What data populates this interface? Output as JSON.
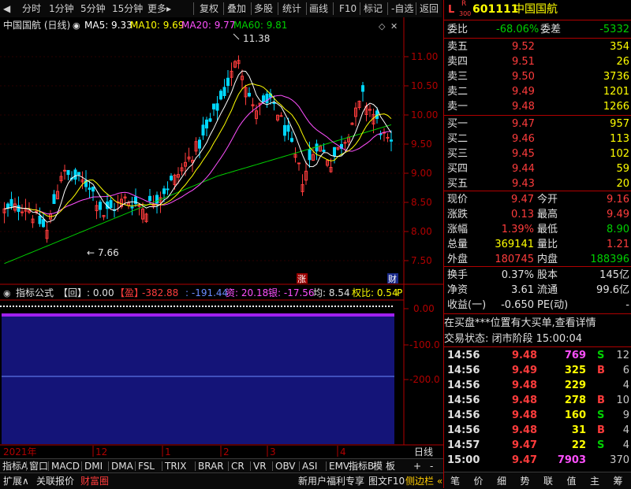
{
  "toolbar": {
    "left_items": [
      "分时",
      "1分钟",
      "5分钟",
      "15分钟",
      "更多"
    ],
    "right_items": [
      "复权",
      "叠加",
      "多股",
      "统计",
      "画线",
      "F10",
      "标记",
      "-自选",
      "返回"
    ]
  },
  "main_chart": {
    "title": "中国国航 (日线)",
    "ma5_label": "MA5: 9.33",
    "ma10_label": "MA10: 9.69",
    "ma20_label": "MA20: 9.77",
    "ma60_label": "MA60: 9.81",
    "high_mark": "11.38",
    "low_mark": "7.66",
    "y_ticks": [
      "11.00",
      "10.50",
      "10.00",
      "9.50",
      "9.00",
      "8.50",
      "8.00",
      "7.50"
    ],
    "badge_zhang": "涨",
    "badge_cai": "财",
    "colors": {
      "up": "#ff3c3c",
      "down": "#00d8ff",
      "ma5": "#ffffff",
      "ma10": "#ffff00",
      "ma20": "#ff50ff",
      "ma60": "#00d000"
    }
  },
  "indicator": {
    "name": "指标公式",
    "hui": "【回】: 0.00",
    "ying": "【盈】",
    "v1": "-382.88",
    "v2": ": -191.44",
    "zi": "资: 20.18",
    "yin": "银: -17.56",
    "jun": "均: 8.54",
    "quanbi": "权比: 0.54",
    "p": "P",
    "y_ticks": [
      "0.00",
      "-100.0",
      "-200.0"
    ]
  },
  "time_axis": {
    "labels": [
      "2021年",
      "12",
      "1",
      "2",
      "3",
      "4"
    ],
    "right_label": "日线"
  },
  "indicator_tabs": [
    "指标A",
    "窗口",
    "MACD",
    "DMI",
    "DMA",
    "FSL",
    "TRIX",
    "BRAR",
    "CR",
    "VR",
    "OBV",
    "ASI",
    "EMV"
  ],
  "indicator_tabs_right": [
    "指标B",
    "模",
    "板",
    "+",
    "-"
  ],
  "bottom_tabs": [
    "扩展∧",
    "关联报价",
    "财富圈"
  ],
  "bottom_right": [
    "新用户福利专享",
    "图文F10",
    "侧边栏 «"
  ],
  "quote": {
    "logo_l": "L",
    "logo_r": "R",
    "logo_num": "300",
    "code": "601111",
    "name": "中国国航",
    "weibi_label": "委比",
    "weibi": "-68.06%",
    "weicha_label": "委差",
    "weicha": "-5332",
    "asks": [
      {
        "label": "卖五",
        "price": "9.52",
        "vol": "354"
      },
      {
        "label": "卖四",
        "price": "9.51",
        "vol": "26"
      },
      {
        "label": "卖三",
        "price": "9.50",
        "vol": "3736"
      },
      {
        "label": "卖二",
        "price": "9.49",
        "vol": "1201"
      },
      {
        "label": "卖一",
        "price": "9.48",
        "vol": "1266"
      }
    ],
    "bids": [
      {
        "label": "买一",
        "price": "9.47",
        "vol": "957"
      },
      {
        "label": "买二",
        "price": "9.46",
        "vol": "113"
      },
      {
        "label": "买三",
        "price": "9.45",
        "vol": "102"
      },
      {
        "label": "买四",
        "price": "9.44",
        "vol": "59"
      },
      {
        "label": "买五",
        "price": "9.43",
        "vol": "20"
      }
    ],
    "stats": [
      {
        "l1": "现价",
        "v1": "9.47",
        "l2": "今开",
        "v2": "9.16"
      },
      {
        "l1": "涨跌",
        "v1": "0.13",
        "l2": "最高",
        "v2": "9.49"
      },
      {
        "l1": "涨幅",
        "v1": "1.39%",
        "l2": "最低",
        "v2": "8.90"
      },
      {
        "l1": "总量",
        "v1": "369141",
        "l2": "量比",
        "v2": "1.21"
      },
      {
        "l1": "外盘",
        "v1": "180745",
        "l2": "内盘",
        "v2": "188396"
      }
    ],
    "stats2": [
      {
        "l1": "换手",
        "v1": "0.37%",
        "l2": "股本",
        "v2": "145亿"
      },
      {
        "l1": "净资",
        "v1": "3.61",
        "l2": "流通",
        "v2": "99.6亿"
      },
      {
        "l1": "收益(一)",
        "v1": "-0.650",
        "l2": "PE(动)",
        "v2": "-"
      }
    ],
    "notice": "在买盘***位置有大买单,查看详情",
    "status": "交易状态: 闭市阶段 15:00:04",
    "trades": [
      {
        "t": "14:56",
        "p": "9.48",
        "v": "769",
        "s": "S",
        "n": "12"
      },
      {
        "t": "14:56",
        "p": "9.49",
        "v": "325",
        "s": "B",
        "n": "6"
      },
      {
        "t": "14:56",
        "p": "9.48",
        "v": "229",
        "s": "",
        "n": "4"
      },
      {
        "t": "14:56",
        "p": "9.48",
        "v": "278",
        "s": "B",
        "n": "10"
      },
      {
        "t": "14:56",
        "p": "9.48",
        "v": "160",
        "s": "S",
        "n": "9"
      },
      {
        "t": "14:56",
        "p": "9.48",
        "v": "31",
        "s": "B",
        "n": "4"
      },
      {
        "t": "14:57",
        "p": "9.47",
        "v": "22",
        "s": "S",
        "n": "4"
      },
      {
        "t": "15:00",
        "p": "9.47",
        "v": "7903",
        "s": "",
        "n": "370"
      }
    ],
    "bottom_tabs": [
      "笔",
      "价",
      "细",
      "势",
      "联",
      "值",
      "主",
      "筹"
    ]
  }
}
